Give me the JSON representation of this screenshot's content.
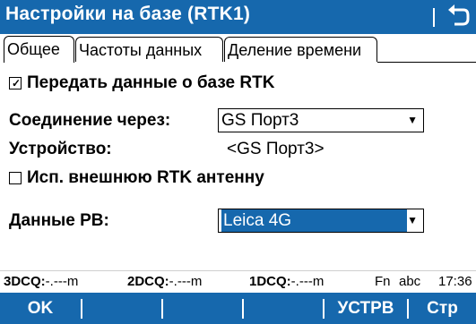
{
  "title": "Настройки на базе (RTK1)",
  "tabs": [
    {
      "label": "Общее"
    },
    {
      "label": "Частоты данных"
    },
    {
      "label": "Деление времени"
    }
  ],
  "send_rtk": {
    "checked": true,
    "label": "Передать данные о базе RTK"
  },
  "connection": {
    "label": "Соединение через:",
    "value": "GS Порт3"
  },
  "device": {
    "label": "Устройство:",
    "value": "<GS Порт3>"
  },
  "external_antenna": {
    "checked": false,
    "label": "Исп. внешнюю RTK антенну"
  },
  "rt_data": {
    "label": "Данные РВ:",
    "value": "Leica 4G"
  },
  "status": {
    "dcq3_label": "3DCQ:",
    "dcq3_value": "-.---m",
    "dcq2_label": "2DCQ:",
    "dcq2_value": "-.---m",
    "dcq1_label": "1DCQ:",
    "dcq1_value": "-.---m",
    "fn": "Fn",
    "input_mode": "abc",
    "time": "17:36"
  },
  "softkeys": {
    "f1": "OK",
    "f2": "",
    "f3": "",
    "f4": "",
    "f5": "УСТРВ",
    "f6": "Стр"
  },
  "colors": {
    "accent": "#1668ad"
  }
}
